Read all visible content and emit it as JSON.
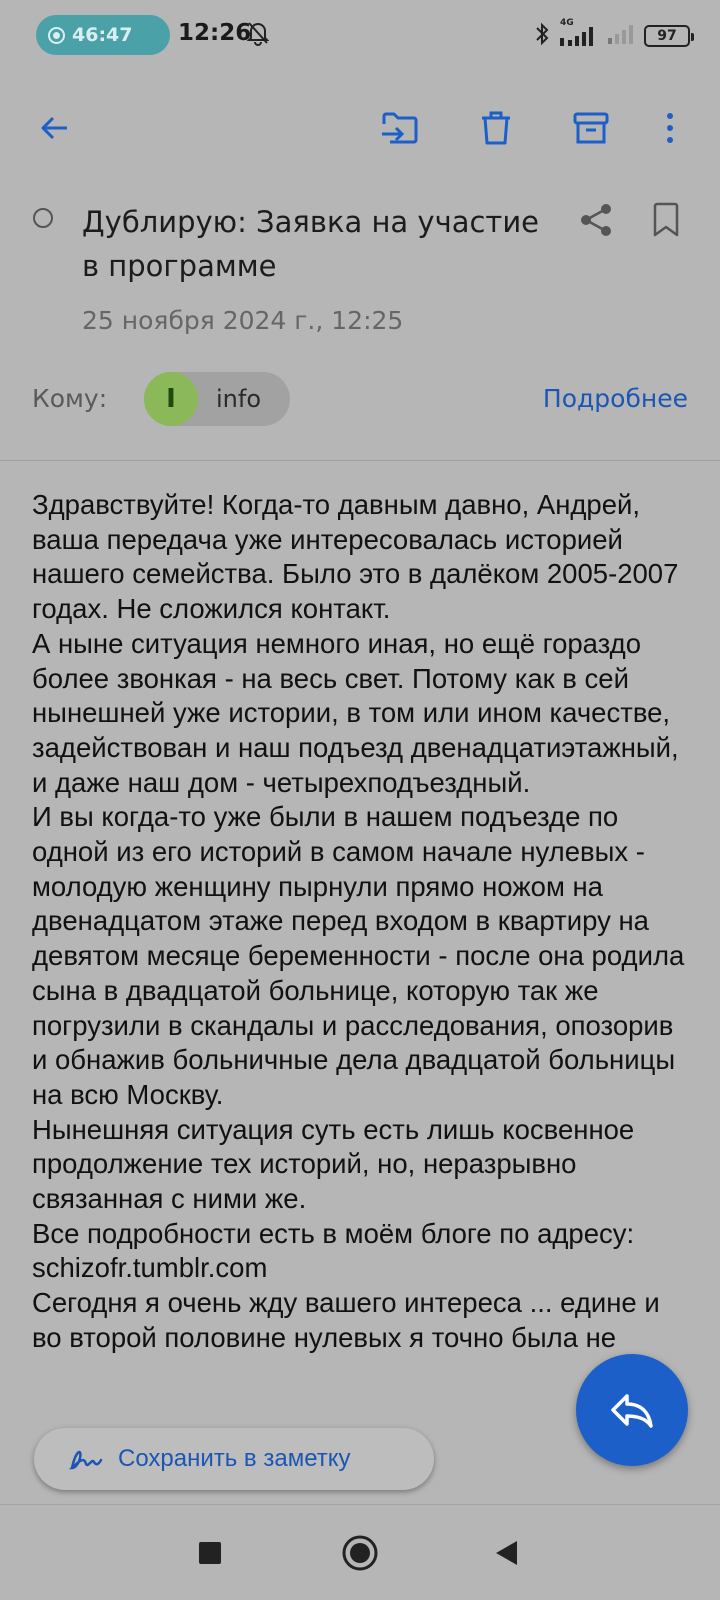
{
  "status_bar": {
    "recording_time": "46:47",
    "clock": "12:26",
    "network_label": "4G",
    "battery": "97"
  },
  "toolbar": {
    "icons": [
      "back-arrow-icon",
      "move-to-folder-icon",
      "trash-icon",
      "archive-icon",
      "more-vert-icon"
    ]
  },
  "email": {
    "subject": "Дублирую: Заявка на участие в программе",
    "date": "25 ноября 2024 г., 12:25",
    "to_label": "Кому:",
    "recipient_initial": "I",
    "recipient_name": "info",
    "details_link": "Подробнее",
    "body": "Здравствуйте! Когда-то давным давно, Андрей, ваша передача уже интересовалась историей нашего семейства. Было это в далёком 2005-2007 годах. Не сложился контакт.\nА ныне ситуация немного иная, но ещё гораздо более звонкая - на весь свет. Потому как в сей нынешней уже истории, в том или ином качестве, задействован и наш подъезд двенадцатиэтажный, и даже наш дом - четырехподъездный.\nИ вы когда-то уже были в нашем подъезде по одной из его историй в самом начале нулевых - молодую женщину пырнули прямо ножом на двенадцатом этаже перед входом в квартиру на девятом месяце беременности - после она родила сына в двадцатой больнице, которую так же погрузили в скандалы и расследования, опозорив и обнажив больничные дела двадцатой больницы на всю Москву.\nНынешняя ситуация суть есть лишь косвенное продолжение тех историй, но, неразрывно связанная с ними же.\nВсе подробности есть в моём блоге по адресу: schizofr.tumblr.com\nСегодня я очень жду вашего интереса ... едине и во второй половине нулевых я точно была не"
  },
  "save_note": {
    "label": "Сохранить в заметку"
  },
  "colors": {
    "accent": "#1c5fc8",
    "link": "#1b56b5",
    "avatar": "#8bb95a",
    "recording_pill": "#4aa2a8"
  }
}
